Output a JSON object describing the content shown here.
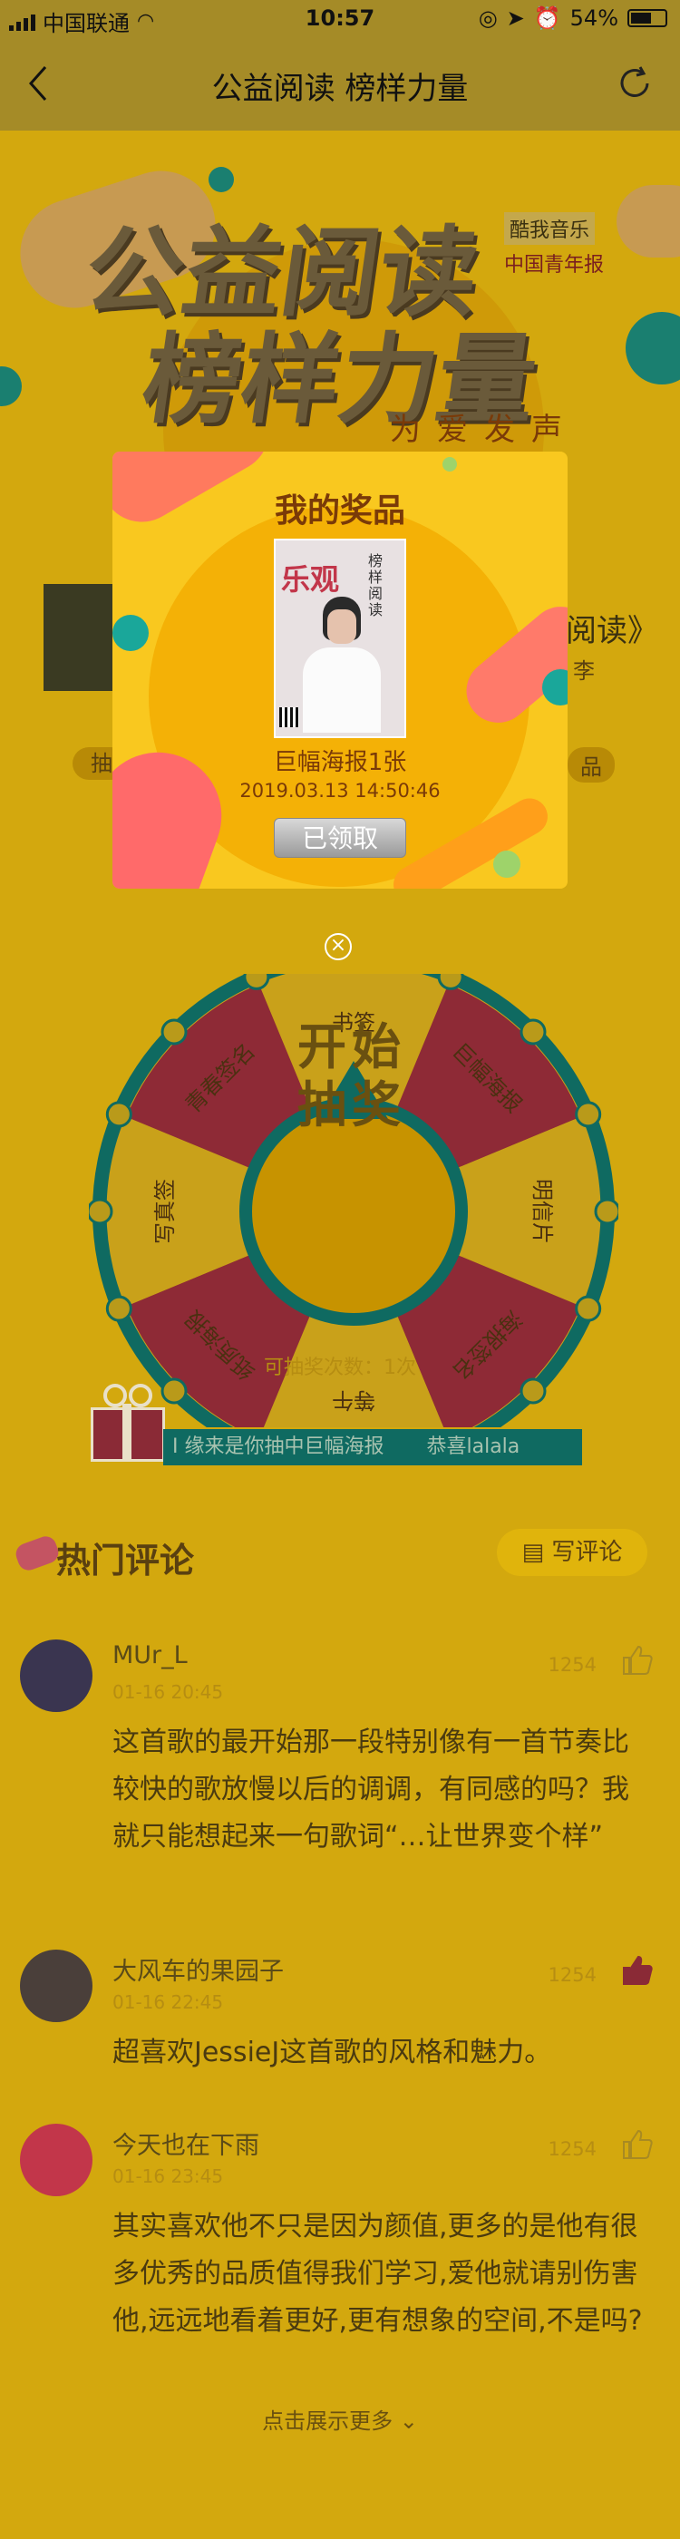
{
  "status_bar": {
    "carrier": "中国联通",
    "time": "10:57",
    "battery": "54%"
  },
  "nav": {
    "title": "公益阅读 榜样力量"
  },
  "banner": {
    "line1": "公益阅读",
    "line2": "榜样力量",
    "slogan": "为爱发声",
    "brand1": "酷我音乐",
    "brand2": "中国青年报"
  },
  "side_cards": {
    "left_partial": "抽",
    "right_title": "阅读》",
    "right_sub": "李",
    "right_tag": "品"
  },
  "wheel": {
    "center_text_1": "开始",
    "center_text_2": "抽奖",
    "segments": [
      "书签",
      "巨幅海报",
      "明信片",
      "海报签名",
      "等午",
      "纸质海报",
      "写真签",
      "青春签名"
    ]
  },
  "draw_info": {
    "remaining": "可抽奖次数：1次"
  },
  "ticker": {
    "text": "I 缘来是你抽中巨幅海报",
    "congrats": "恭喜lalala"
  },
  "modal": {
    "title": "我的奖品",
    "prize_name": "巨幅海报1张",
    "prize_time": "2019.03.13 14:50:46",
    "claim_label": "已领取",
    "poster_title": "乐观",
    "poster_side": "榜样阅读"
  },
  "comments_section": {
    "title": "热门评论",
    "write_label": "写评论",
    "show_more": "点击展示更多",
    "items": [
      {
        "name": "MUr_L",
        "time": "01-16 20:45",
        "likes": "1254",
        "liked": false,
        "body": "这首歌的最开始那一段特别像有一首节奏比较快的歌放慢以后的调调，有同感的吗？我就只能想起来一句歌词“…让世界变个样”"
      },
      {
        "name": "大风车的果园子",
        "time": "01-16 22:45",
        "likes": "1254",
        "liked": true,
        "body": "超喜欢JessieJ这首歌的风格和魅力。"
      },
      {
        "name": "今天也在下雨",
        "time": "01-16 23:45",
        "likes": "1254",
        "liked": false,
        "body": "其实喜欢他不只是因为颜值,更多的是他有很多优秀的品质值得我们学习,爱他就请别伤害他,远远地看着更好,更有想象的空间,不是吗?"
      }
    ]
  },
  "colors": {
    "page_bg": "#d3a80e",
    "modal_bg": "#f9c81f",
    "accent_red": "#c2364a",
    "teal": "#1aa79a"
  }
}
